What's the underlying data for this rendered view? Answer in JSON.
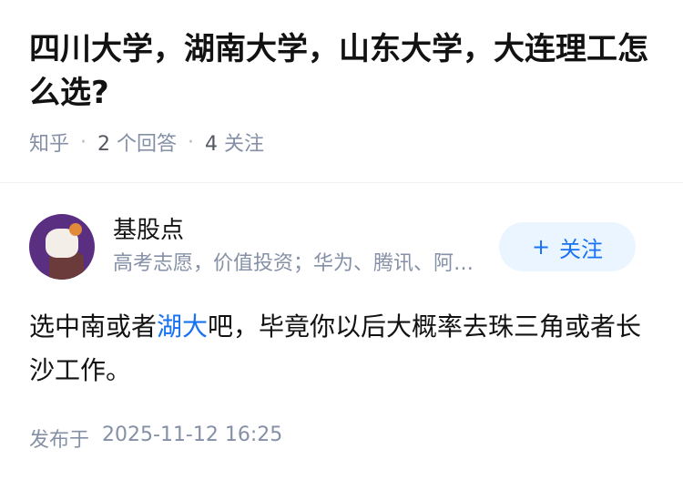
{
  "question": {
    "title": "四川大学，湖南大学，山东大学，大连理工怎么选?",
    "source": "知乎",
    "answer_count": "2",
    "answer_label": "个回答",
    "follower_count": "4",
    "follower_label": "关注"
  },
  "answer": {
    "author_name": "基股点",
    "author_bio": "高考志愿，价值投资；华为、腾讯、阿里、小米…",
    "follow_icon": "+",
    "follow_label": "关注",
    "content_before": "选中南或者",
    "content_link": "湖大",
    "content_after": "吧，毕竟你以后大概率去珠三角或者长沙工作。",
    "published_label": "发布于",
    "published_time": "2025-11-12 16:25"
  },
  "colors": {
    "link": "#1772f6",
    "follow_bg": "#ebf5ff",
    "meta_gray": "#8590a6"
  }
}
